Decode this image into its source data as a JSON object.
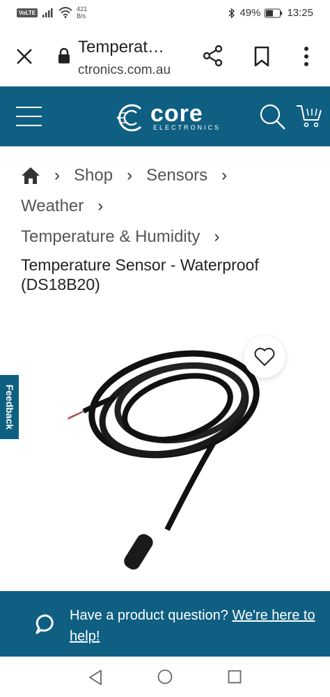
{
  "status_bar": {
    "volte": "VoLTE",
    "net_speed_value": "421",
    "net_speed_unit": "B/s",
    "battery": "49%",
    "time": "13:25"
  },
  "browser": {
    "title": "Temperat…",
    "url": "ctronics.com.au"
  },
  "header": {
    "logo_text": "core",
    "logo_sub": "ELECTRONICS",
    "brand_color": "#0f5f82"
  },
  "breadcrumb": {
    "items": [
      "Shop",
      "Sensors",
      "Weather",
      "Temperature & Humidity"
    ]
  },
  "product": {
    "title": "Temperature Sensor - Waterproof (DS18B20)"
  },
  "feedback": {
    "label": "Feedback"
  },
  "help": {
    "text": "Have a product question?",
    "link": "We're here to help!"
  }
}
